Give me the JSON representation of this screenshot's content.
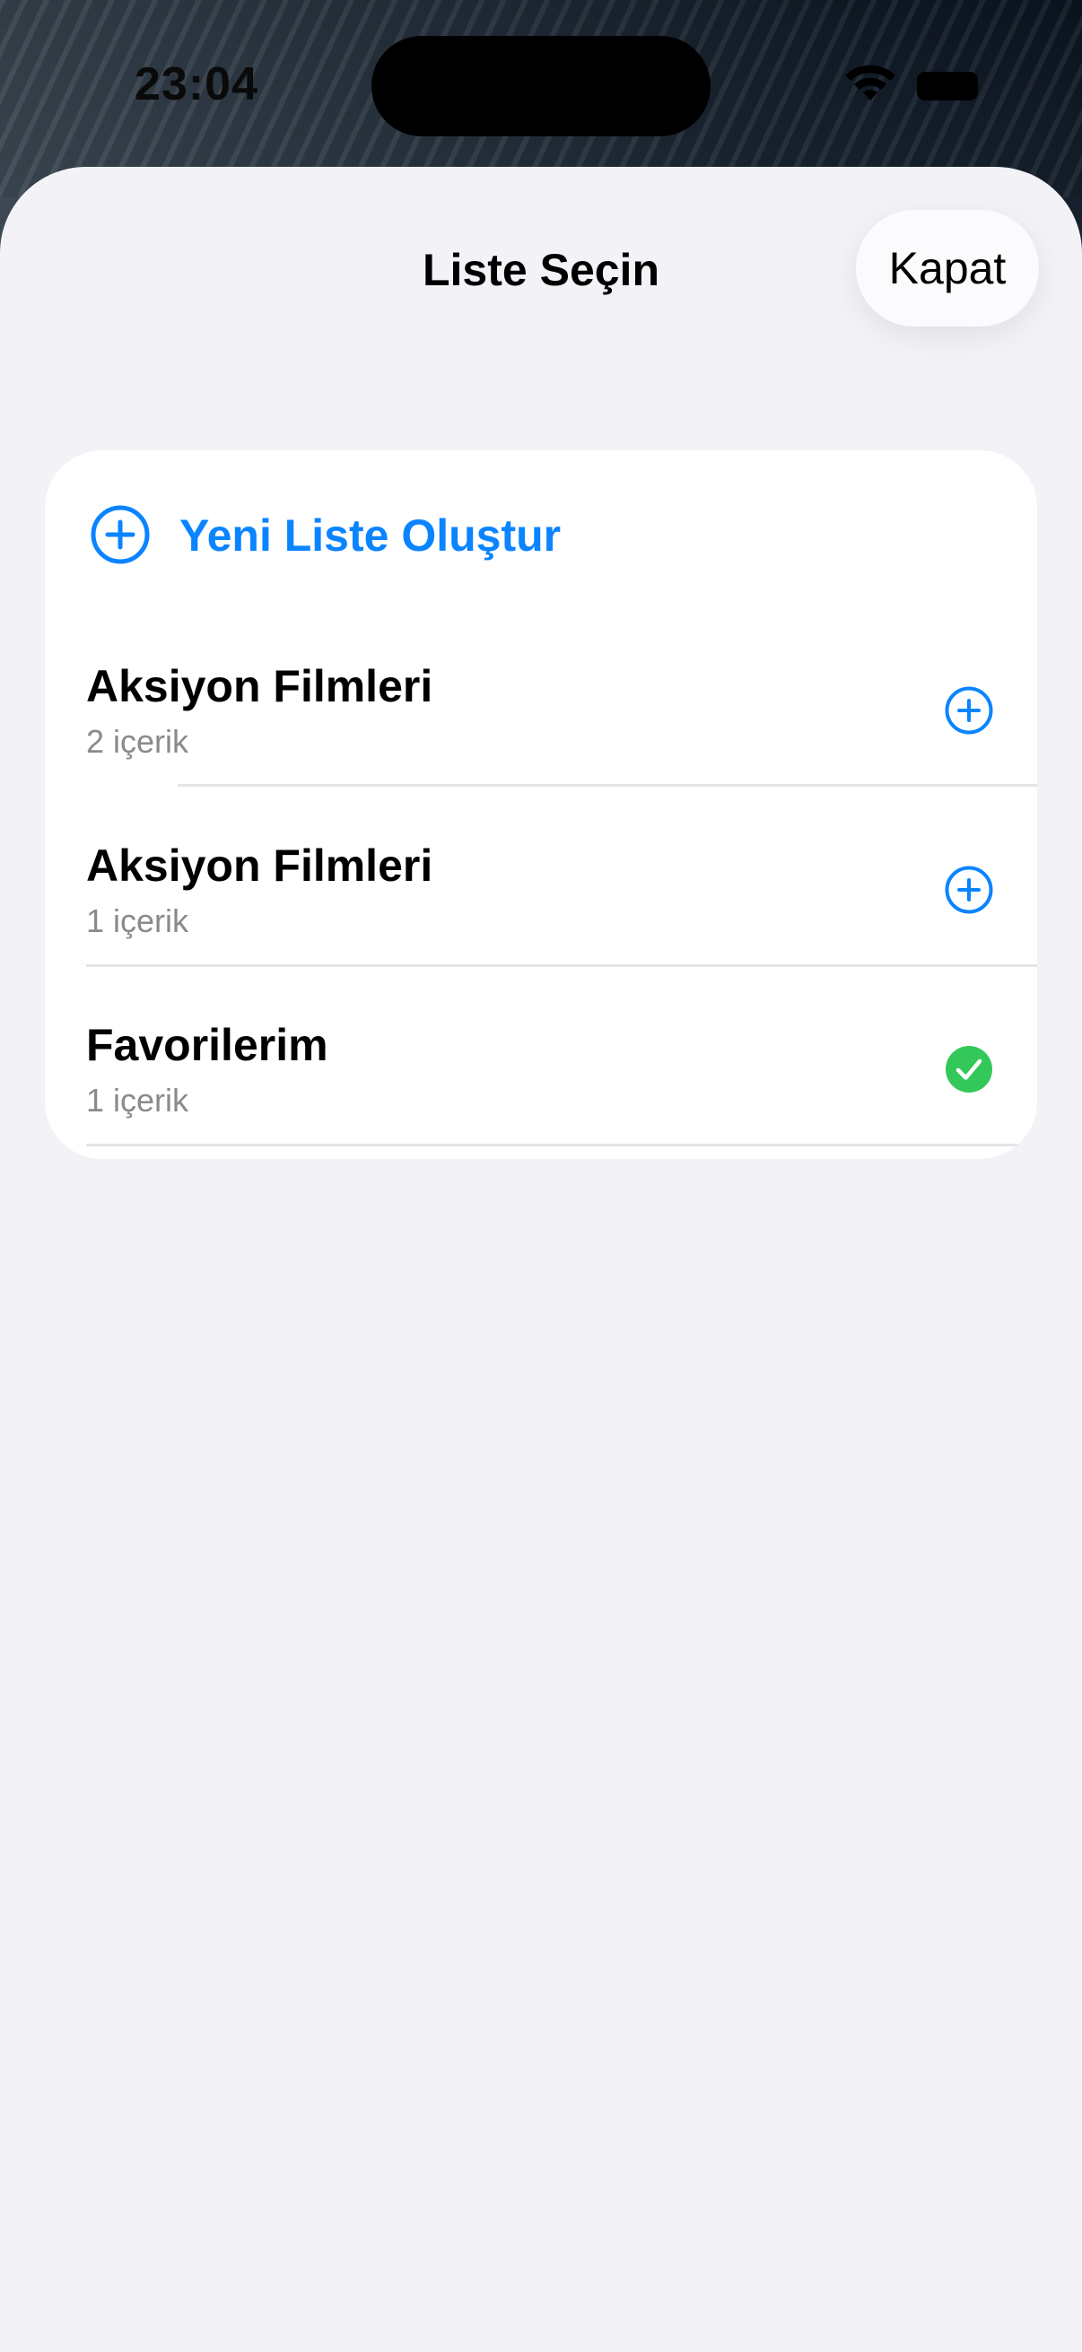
{
  "status_bar": {
    "time": "23:04",
    "wifi_icon": "wifi-icon",
    "battery_icon": "battery-icon"
  },
  "sheet": {
    "title": "Liste Seçin",
    "close_label": "Kapat"
  },
  "new_list": {
    "label": "Yeni Liste Oluştur",
    "icon": "plus-circle-icon"
  },
  "lists": [
    {
      "title": "Aksiyon Filmleri",
      "count": "2 içerik",
      "action_icon": "plus-circle-icon",
      "selected": false
    },
    {
      "title": "Aksiyon Filmleri",
      "count": "1 içerik",
      "action_icon": "plus-circle-icon",
      "selected": false
    },
    {
      "title": "Favorilerim",
      "count": "1 içerik",
      "action_icon": "checkmark-circle-icon",
      "selected": true
    }
  ],
  "colors": {
    "accent": "#0a84ff",
    "selected": "#34c759",
    "sheet_background": "#f2f2f7",
    "card_background": "#ffffff",
    "secondary_text": "#8a8a8e"
  }
}
